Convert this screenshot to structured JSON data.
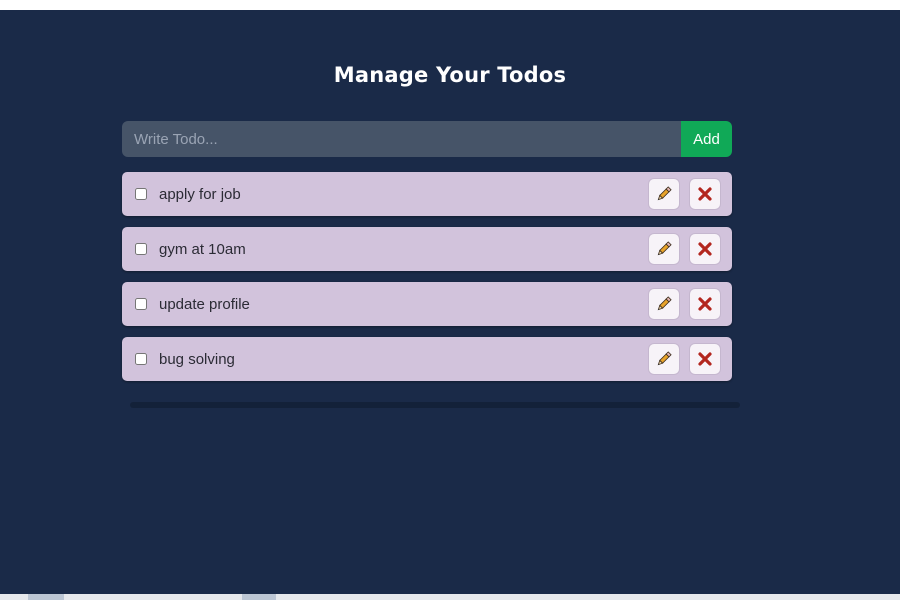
{
  "page": {
    "title": "Manage Your Todos"
  },
  "add_form": {
    "placeholder": "Write Todo...",
    "value": "",
    "add_label": "Add"
  },
  "todos": [
    {
      "text": "apply for job",
      "done": false
    },
    {
      "text": "gym at 10am",
      "done": false
    },
    {
      "text": "update profile",
      "done": false
    },
    {
      "text": "bug solving",
      "done": false
    }
  ],
  "icons": {
    "edit": "pencil-icon",
    "delete": "cross-icon"
  },
  "colors": {
    "background": "#1a2a48",
    "input_background": "#465468",
    "add_button": "#10a957",
    "todo_item": "#d2c3dc",
    "delete_icon": "#b3261e",
    "edit_icon": "#e8a32a"
  }
}
